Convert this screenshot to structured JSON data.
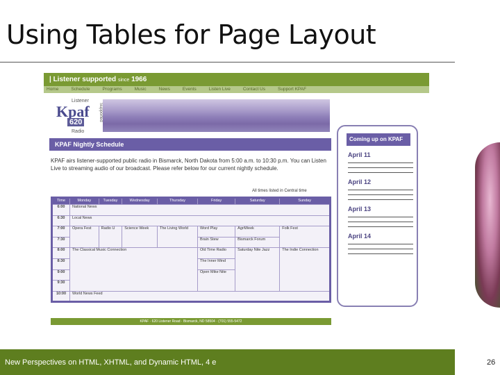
{
  "slide": {
    "title": "Using Tables for Page Layout",
    "footer": "New Perspectives on HTML, XHTML, and Dynamic HTML, 4 e",
    "page_number": "26"
  },
  "site": {
    "top_bar": "| Listener supported",
    "since": "since",
    "year": "1966",
    "nav": [
      "Home",
      "Schedule",
      "Programs",
      "Music",
      "News",
      "Events",
      "Listen Live",
      "Contact Us",
      "Support KPAF"
    ],
    "logo": {
      "listener": "Listener",
      "name": "Kpaf",
      "frequency": "620",
      "radio": "Radio",
      "supported": "Supported"
    },
    "schedule_heading": "KPAF Nightly Schedule",
    "intro": "KPAF airs listener-supported public radio in Bismarck, North Dakota from 5:00 a.m. to 10:30 p.m. You can Listen Live to streaming audio of our broadcast. Please refer below for our current nightly schedule.",
    "all_times_note": "All times listed in Central time",
    "schedule": {
      "headers": [
        "Time",
        "Monday",
        "Tuesday",
        "Wednesday",
        "Thursday",
        "Friday",
        "Saturday",
        "Sunday"
      ],
      "rows": [
        [
          "6:00",
          "National News",
          "",
          "",
          "",
          "",
          "",
          ""
        ],
        [
          "6:30",
          "Local News",
          "",
          "",
          "",
          "",
          "",
          ""
        ],
        [
          "7:00",
          "Opera Fest",
          "Radio U",
          "Science Week",
          "The Living World",
          "Word Play",
          "AgriWeek",
          "Folk Fest"
        ],
        [
          "7:30",
          "",
          "",
          "",
          "",
          "Brain Stew",
          "Bismarck Forum",
          ""
        ],
        [
          "8:00",
          "The Classical Music Connection",
          "",
          "",
          "",
          "Old Time Radio",
          "Saturday Nite Jazz",
          "The Indie Connection"
        ],
        [
          "8:30",
          "",
          "",
          "",
          "",
          "The Inner Mind",
          "",
          ""
        ],
        [
          "9:00",
          "",
          "",
          "",
          "",
          "Open Mike Nite",
          "",
          ""
        ],
        [
          "9:30",
          "",
          "",
          "",
          "",
          "",
          "",
          ""
        ],
        [
          "10:00",
          "World News Feed",
          "",
          "",
          "",
          "",
          "",
          ""
        ]
      ]
    },
    "footer_text": "KPAF · 620 Listener Road · Bismarck, ND 58504 · (701) 555-5472",
    "coming_up": {
      "heading": "Coming up on KPAF",
      "dates": [
        "April 11",
        "April 12",
        "April 13",
        "April 14"
      ]
    }
  }
}
